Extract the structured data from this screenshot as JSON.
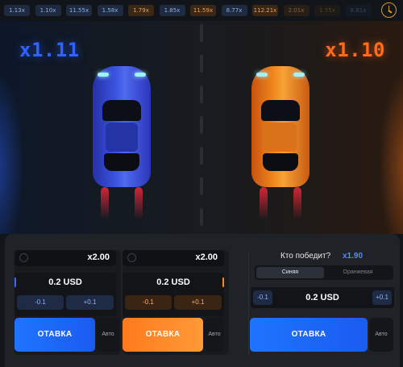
{
  "history": [
    {
      "value": "1.13x",
      "color": "blue",
      "dim": 0
    },
    {
      "value": "1.10x",
      "color": "blue",
      "dim": 0
    },
    {
      "value": "11.55x",
      "color": "blue",
      "dim": 0
    },
    {
      "value": "1.58x",
      "color": "blue",
      "dim": 0
    },
    {
      "value": "1.79x",
      "color": "orange",
      "dim": 0
    },
    {
      "value": "1.85x",
      "color": "blue",
      "dim": 0
    },
    {
      "value": "11.59x",
      "color": "orange",
      "dim": 0
    },
    {
      "value": "8.77x",
      "color": "blue",
      "dim": 0
    },
    {
      "value": "112.21x",
      "color": "orange",
      "dim": 0
    },
    {
      "value": "2.01x",
      "color": "orange",
      "dim": 1
    },
    {
      "value": "1.55x",
      "color": "orange",
      "dim": 2
    },
    {
      "value": "8.81x",
      "color": "blue",
      "dim": 2
    }
  ],
  "history_icon": "clock-icon",
  "race": {
    "blue_multiplier": "x1.11",
    "orange_multiplier": "x1.10",
    "colors": {
      "blue": "#2f63ff",
      "orange": "#ff6a1c"
    }
  },
  "bets": [
    {
      "coef": "x2.00",
      "amount": "0.2 USD",
      "minus": "-0.1",
      "plus": "+0.1",
      "stake": "ОТАВКА",
      "auto": "Авто",
      "theme": "blue"
    },
    {
      "coef": "x2.00",
      "amount": "0.2 USD",
      "minus": "-0.1",
      "plus": "+0.1",
      "stake": "ОТАВКА",
      "auto": "Авто",
      "theme": "orange"
    }
  ],
  "winner": {
    "question": "Кто победит?",
    "odds": "x1.90",
    "tabs": [
      "Синяя",
      "Оранжевая"
    ],
    "active_tab": "Синяя",
    "minus": "-0.1",
    "plus": "+0.1",
    "amount": "0.2 USD",
    "stake": "ОТАВКА",
    "auto": "Авто"
  }
}
